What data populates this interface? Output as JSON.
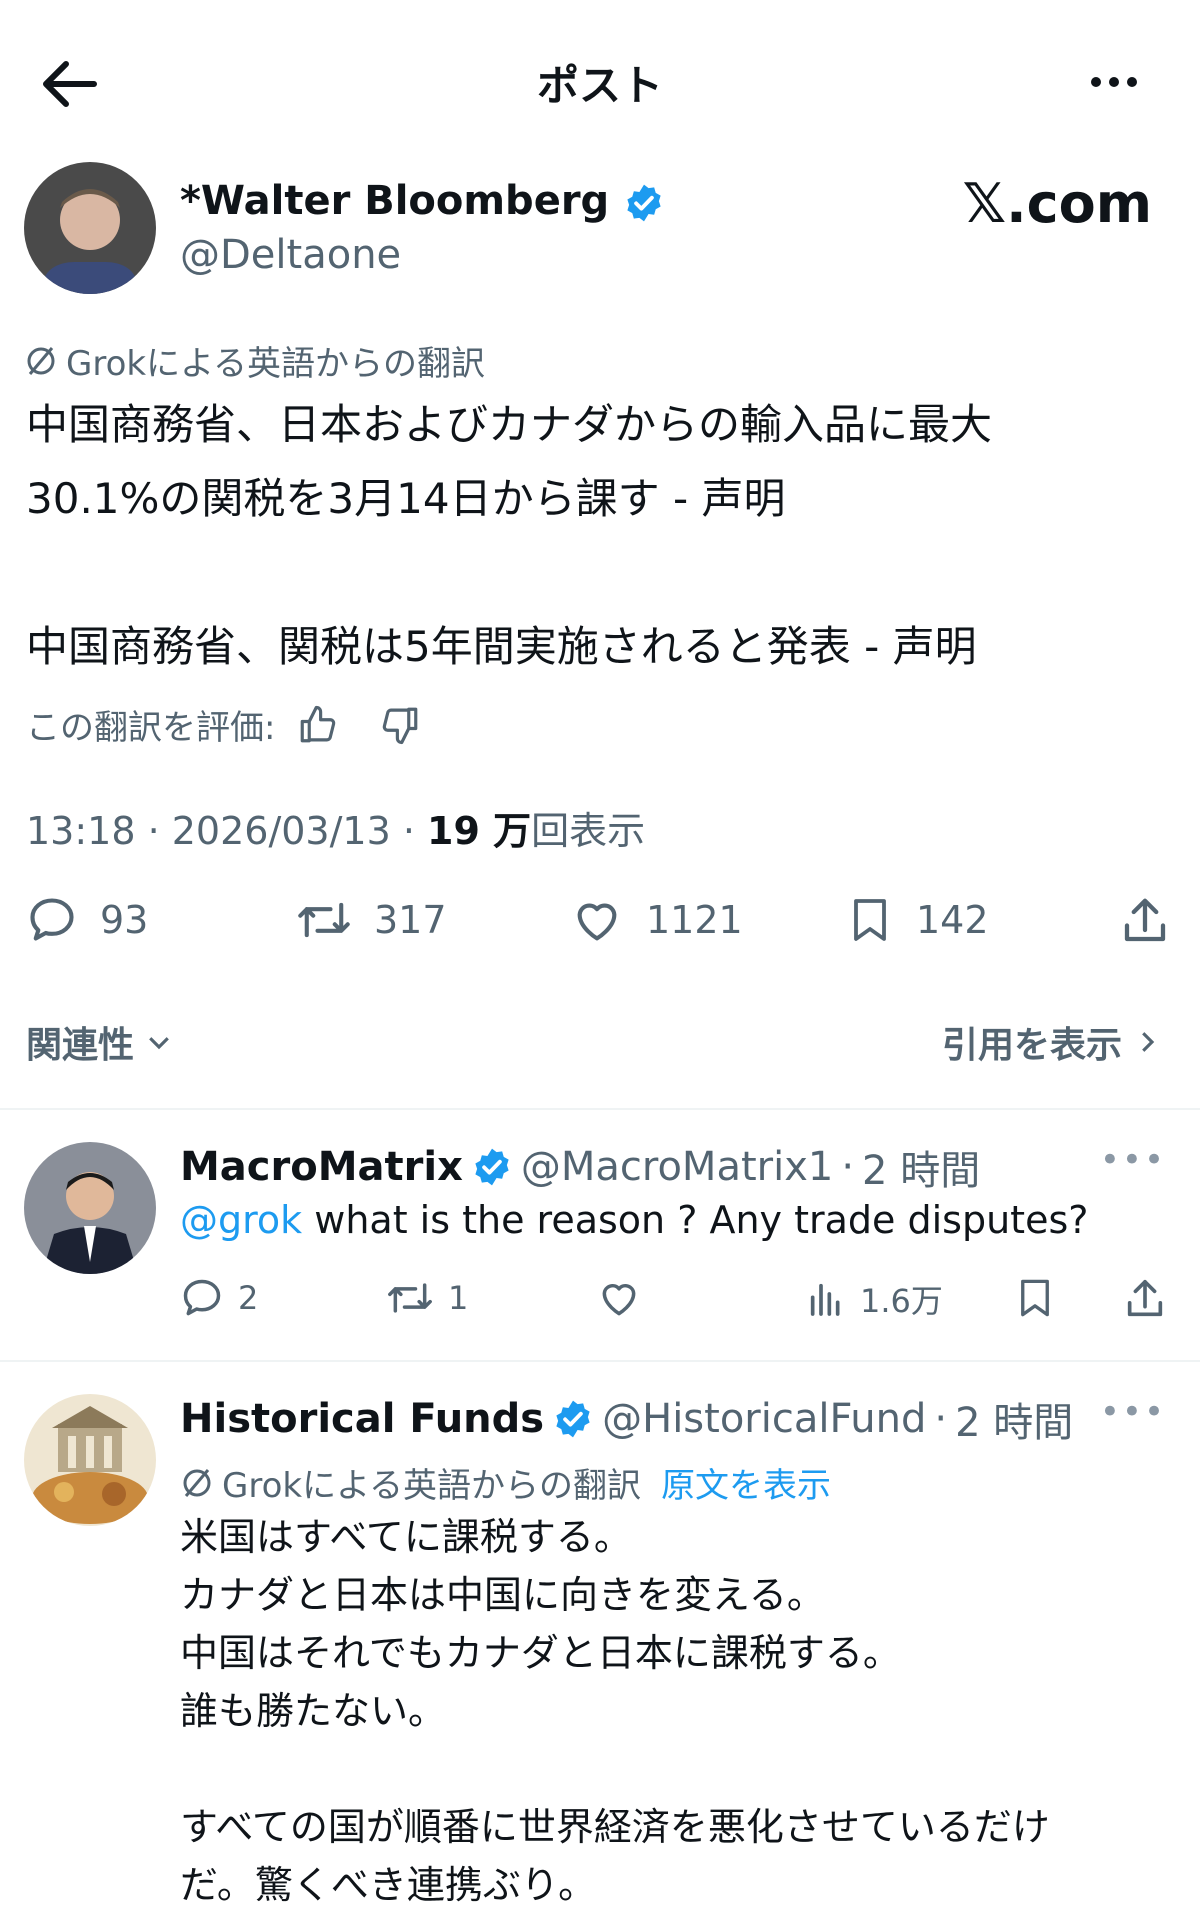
{
  "header": {
    "title": "ポスト"
  },
  "watermark": "𝕏.com",
  "post": {
    "author_name": "*Walter Bloomberg",
    "author_handle": "@Deltaone",
    "translation_note": "Grokによる英語からの翻訳",
    "text_line1": "中国商務省、日本およびカナダからの輸入品に最大",
    "text_line2": "30.1%の関税を3月14日から課す - 声明",
    "text_line3": "中国商務省、関税は5年間実施されると発表 - 声明",
    "rate_label": "この翻訳を評価:",
    "timestamp": "13:18 · 2026/03/13 · ",
    "views_count": "19 万",
    "views_label": "回表示",
    "stats": {
      "replies": "93",
      "reposts": "317",
      "likes": "1121",
      "bookmarks": "142"
    }
  },
  "sort": {
    "relevance": "関連性",
    "quotes": "引用を表示"
  },
  "replies": [
    {
      "name": "MacroMatrix",
      "handle": "@MacroMatrix1",
      "time": "2 時間",
      "mention": "@grok",
      "text": " what is the reason ? Any trade disputes?",
      "stats": {
        "replies": "2",
        "reposts": "1",
        "views": "1.6万"
      }
    },
    {
      "name": "Historical Funds",
      "handle": "@HistoricalFund",
      "time": "2 時間",
      "translation_note": "Grokによる英語からの翻訳",
      "show_original": "原文を表示",
      "lines": [
        "米国はすべてに課税する。",
        "カナダと日本は中国に向きを変える。",
        "中国はそれでもカナダと日本に課税する。",
        "誰も勝たない。",
        "すべての国が順番に世界経済を悪化させているだけ",
        "だ。驚くべき連携ぶり。"
      ]
    }
  ],
  "colors": {
    "accent": "#1d9bf0",
    "text": "#0f1419",
    "muted": "#536471"
  }
}
